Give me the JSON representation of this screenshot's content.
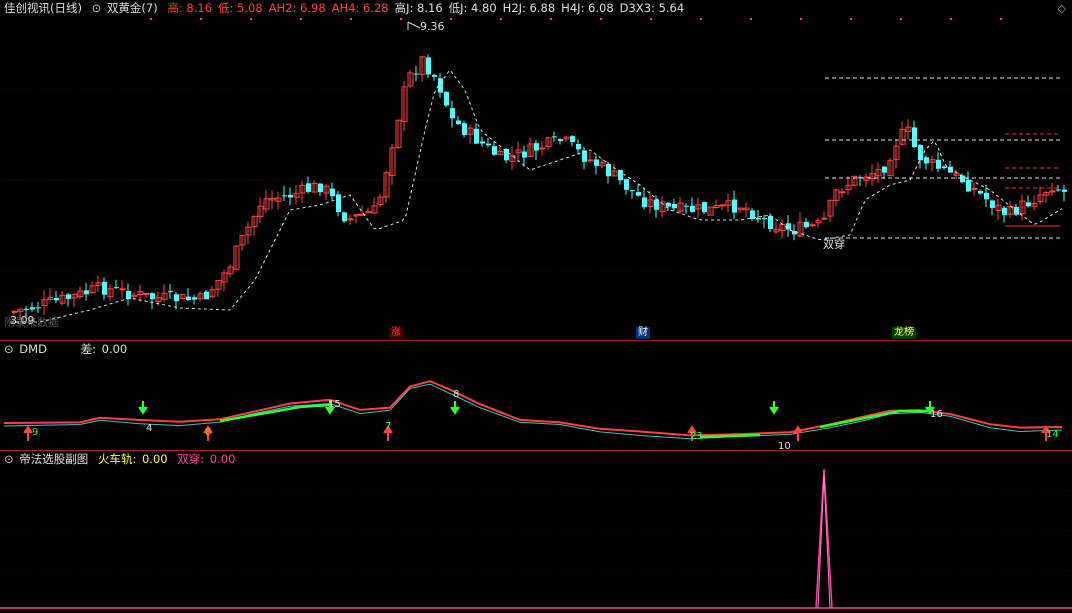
{
  "header": {
    "app_title": "佳创视讯(日线)",
    "indicator_icon": "circle-caret-icon",
    "indicator_name": "双黄金(7)",
    "items": [
      {
        "label": "高:",
        "value": "8.16",
        "color": "#ff4040"
      },
      {
        "label": "低:",
        "value": "5.08",
        "color": "#ff4040"
      },
      {
        "label": "AH2:",
        "value": "6.98",
        "color": "#ff4040"
      },
      {
        "label": "AH4:",
        "value": "6.28",
        "color": "#ff4040"
      },
      {
        "label": "高J:",
        "value": "8.16",
        "color": "#e0e0e0"
      },
      {
        "label": "低J:",
        "value": "4.80",
        "color": "#e0e0e0"
      },
      {
        "label": "H2J:",
        "value": "6.88",
        "color": "#e0e0e0"
      },
      {
        "label": "H4J:",
        "value": "6.08",
        "color": "#e0e0e0"
      },
      {
        "label": "D3X3:",
        "value": "5.64",
        "color": "#e0e0e0"
      }
    ],
    "settings_icon": "diamond-icon"
  },
  "main_chart": {
    "high_label": "9.36",
    "low_label": "3.09",
    "overlay_text": "附录来数据",
    "signal_label": "双穿",
    "event_tags": [
      {
        "text": "涨",
        "color": "#ff3030",
        "bg": "#400000"
      },
      {
        "text": "财",
        "color": "#ffffff",
        "bg": "#003080"
      },
      {
        "text": "龙榜",
        "color": "#ffff60",
        "bg": "#004000"
      }
    ]
  },
  "dmd_panel": {
    "name": "DMD",
    "diff_label": "差:",
    "diff_value": "0.00",
    "marker_labels": [
      "9",
      "4",
      "8",
      "15",
      "7",
      "8",
      "23",
      "10",
      "16",
      "14"
    ]
  },
  "sub_panel": {
    "name": "帝法选股副图",
    "train_label": "火车轨:",
    "train_value": "0.00",
    "cross_label": "双穿:",
    "cross_value": "0.00"
  },
  "colors": {
    "up": "#ff4040",
    "down": "#54fcfc",
    "separator": "#a02020",
    "green_line": "#30ff30",
    "magenta": "#ff40a0"
  }
}
